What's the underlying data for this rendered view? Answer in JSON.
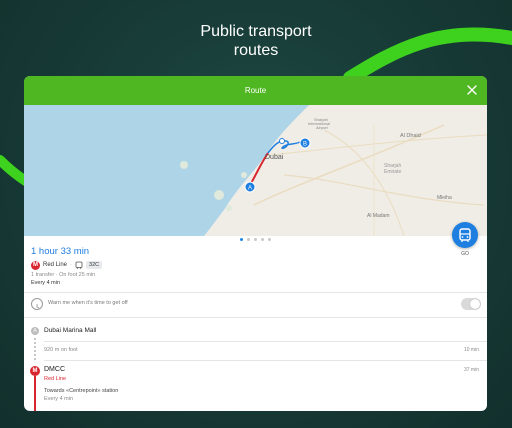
{
  "headline": {
    "line1": "Public transport",
    "line2": "routes"
  },
  "window": {
    "title": "Route",
    "close_icon": "close-icon"
  },
  "map": {
    "labels": {
      "dubai": "Dubai",
      "al_dhaid": "Al Dhaid",
      "sharjah_emirate": "Sharjah\nEmirate",
      "al_madam": "Al Madam",
      "mleiha": "Mleiha",
      "sharjah_airport": "Sharjah\nInternational\nAirport"
    },
    "marker_a": "A",
    "marker_b": "B",
    "pages_count": 5,
    "active_page": 1
  },
  "go_button": {
    "icon": "bus-icon",
    "label": "GO"
  },
  "summary": {
    "duration": "1 hour 33 min",
    "line_name": "Red Line",
    "bus_number": "32C",
    "transfers_walk": "1 transfer · On foot 25 min",
    "frequency": "Every 4 min"
  },
  "alert": {
    "text": "Warn me when it's time to get off",
    "enabled": false
  },
  "steps": {
    "start_marker": "A",
    "start_name": "Dubai Marina Mall",
    "walk_text": "920 m on foot",
    "walk_time": "10 min",
    "metro_stop": "DMCC",
    "metro_line": "Red Line",
    "metro_time": "37 min",
    "towards": "Towards «Centrepoint» station",
    "metro_frequency": "Every 4 min"
  },
  "colors": {
    "brand_green": "#4fb722",
    "accent_blue": "#1e7fe0",
    "metro_red": "#d8262e",
    "background": "#173a36"
  }
}
